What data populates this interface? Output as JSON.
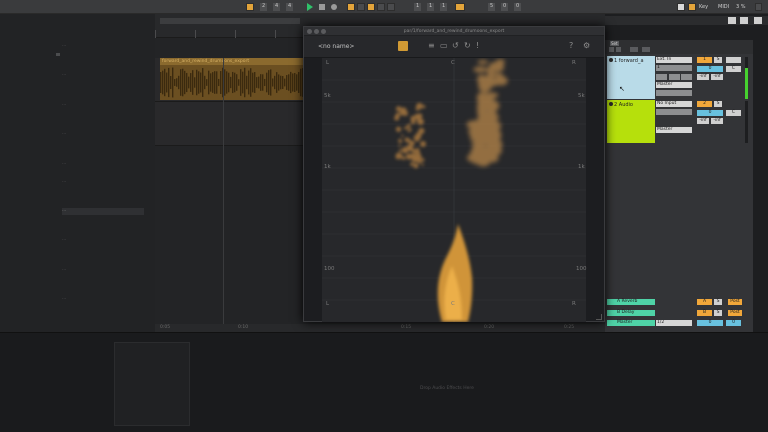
{
  "transport": {
    "tempo_fields": [
      "2",
      "4",
      "4"
    ],
    "position": [
      "1",
      "1",
      "1"
    ],
    "loop_length": [
      "5",
      "0",
      "0"
    ],
    "key_label": "Key",
    "midi_label": "MIDI",
    "cpu_label": "3 %",
    "accent_color": "#e3a43a",
    "play_color": "#2fc26a"
  },
  "browser": {
    "items": [
      "...",
      "...",
      "...",
      "...",
      "...",
      "...",
      "...",
      "...",
      "...",
      "..."
    ]
  },
  "arrangement": {
    "clip_name": "forward_and_rewind_drumoons_export",
    "timeline_labels": [
      "0:05",
      "0:10",
      "0:15",
      "0:20",
      "0:25"
    ]
  },
  "plugin": {
    "window_title": "par/1/forward_and_rewind_drumoons_export",
    "preset_name": "<no name>",
    "top_left_label": "L",
    "top_center_label": "C",
    "top_right_label": "R",
    "bottom_left_label": "L",
    "bottom_center_label": "C",
    "bottom_right_label": "R",
    "freq_labels_left": [
      "5k",
      "1k",
      "100"
    ],
    "freq_labels_right": [
      "5k",
      "1k",
      "100"
    ],
    "power_color": "#d19a34",
    "signal_color": "#c98a35"
  },
  "mixer": {
    "set_label": "Set",
    "tracks": [
      {
        "name": "1 forward_a",
        "color": "#b9dbe8",
        "input": "Ext. In",
        "input_channel": "1",
        "output": "Master",
        "buttons": [
          "1",
          "S",
          "0",
          "C"
        ],
        "volume": "-inf",
        "send": "-inf"
      },
      {
        "name": "2 Audio",
        "color": "#b6e00c",
        "input": "No Input",
        "output": "Master",
        "buttons": [
          "2",
          "S",
          "0",
          "C"
        ],
        "volume": "-inf",
        "send": "-inf"
      }
    ],
    "returns": [
      {
        "name": "A Reverb",
        "button": "A",
        "solo": "S",
        "post": "Post"
      },
      {
        "name": "B Delay",
        "button": "B",
        "solo": "S",
        "post": "Post"
      },
      {
        "name": "Master",
        "input": "1/2",
        "button": "0",
        "post": "0"
      }
    ]
  },
  "device_view": {
    "hint": "Drop Audio Effects Here"
  }
}
